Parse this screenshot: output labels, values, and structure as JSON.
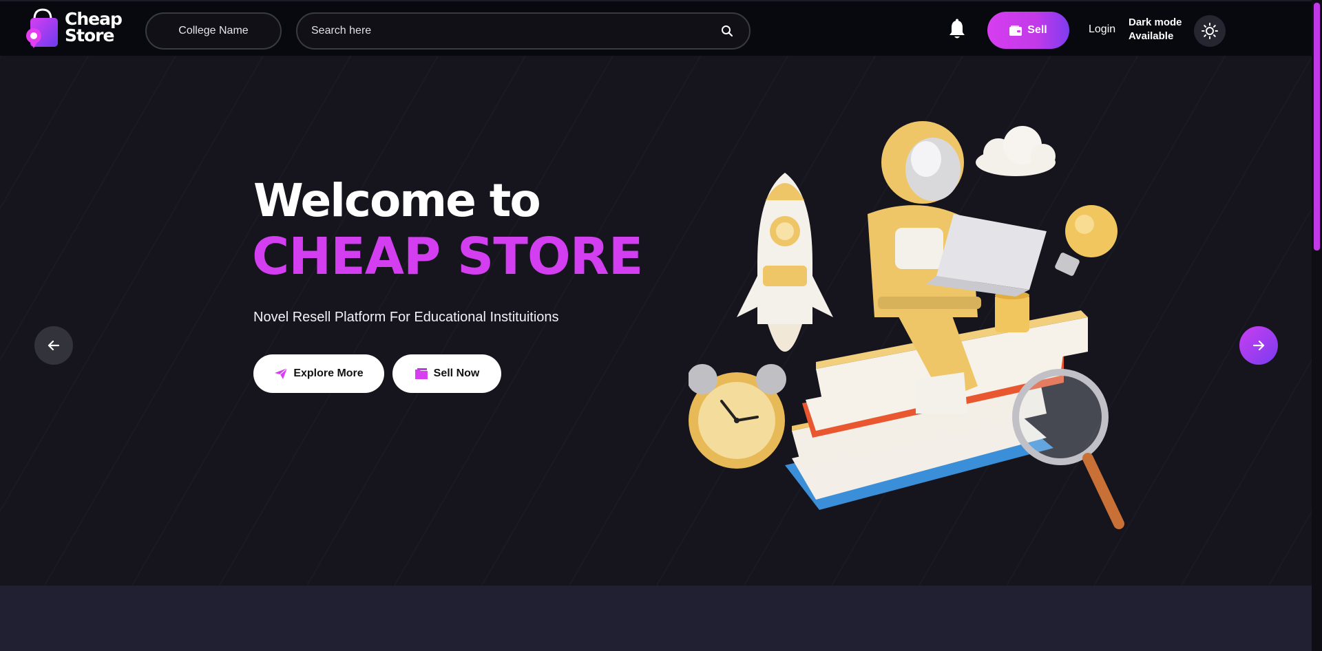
{
  "brand": {
    "line1": "Cheap",
    "line2": "Store"
  },
  "nav": {
    "college_label": "College Name",
    "search_placeholder": "Search here",
    "sell_label": "Sell",
    "login_label": "Login",
    "darkmode_line1": "Dark mode",
    "darkmode_line2": "Available"
  },
  "hero": {
    "title": "Welcome to",
    "brand_title": "CHEAP STORE",
    "subtitle": "Novel Resell Platform For Educational Instituitions",
    "explore_label": "Explore More",
    "sellnow_label": "Sell Now"
  },
  "icons": {
    "search": "search-icon",
    "bell": "bell-icon",
    "wallet": "wallet-icon",
    "sun": "sun-icon",
    "paper_plane": "paper-plane-icon",
    "folder": "folder-icon",
    "arrow_left": "arrow-left-icon",
    "arrow_right": "arrow-right-icon"
  },
  "colors": {
    "accent": "#d23ef0",
    "accent_secondary": "#7a3cf0",
    "background": "#16151e",
    "navbar": "#08080f"
  }
}
